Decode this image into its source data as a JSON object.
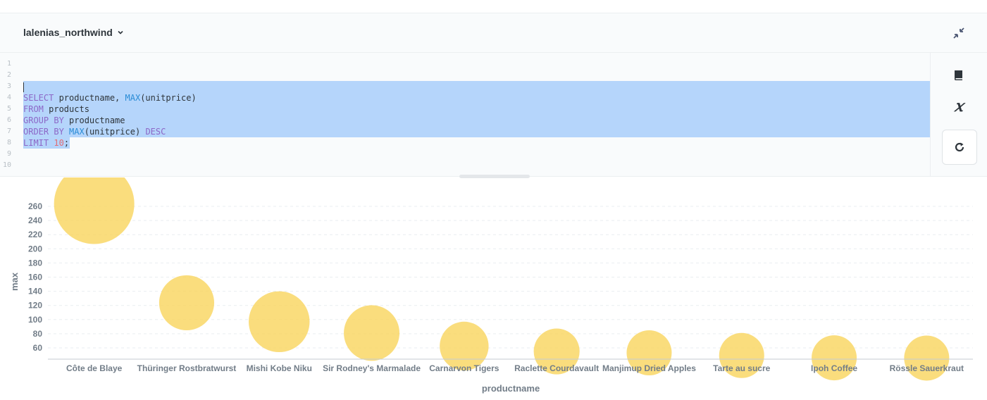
{
  "database": {
    "name": "lalenias_northwind"
  },
  "editor": {
    "line_numbers": [
      "1",
      "2",
      "3",
      "4",
      "5",
      "6",
      "7",
      "8",
      "9",
      "10"
    ],
    "query": [
      "",
      "",
      "",
      "SELECT productname, MAX(unitprice)",
      "FROM products",
      "GROUP BY productname",
      "ORDER BY MAX(unitprice) DESC",
      "LIMIT 10;",
      "",
      ""
    ]
  },
  "icons": {
    "collapse": "collapse-icon",
    "reference": "book-icon",
    "variables": "variable-x-icon",
    "run": "refresh-icon",
    "dropdown": "chevron-down-icon"
  },
  "colors": {
    "bubble": "#f9d45c",
    "accent": "#509ee3"
  },
  "chart_data": {
    "type": "scatter",
    "xlabel": "productname",
    "ylabel": "max",
    "categories": [
      "Côte de Blaye",
      "Thüringer Rostbratwurst",
      "Mishi Kobe Niku",
      "Sir Rodney's Marmalade",
      "Carnarvon Tigers",
      "Raclette Courdavault",
      "Manjimup Dried Apples",
      "Tarte au sucre",
      "Ipoh Coffee",
      "Rössle Sauerkraut"
    ],
    "values": [
      263.5,
      123.79,
      97,
      81,
      62.5,
      55,
      53,
      49.3,
      46,
      45.6
    ],
    "yticks": [
      60,
      80,
      100,
      120,
      140,
      160,
      180,
      200,
      220,
      240,
      260
    ],
    "ylim": [
      40,
      280
    ],
    "grid": true
  }
}
